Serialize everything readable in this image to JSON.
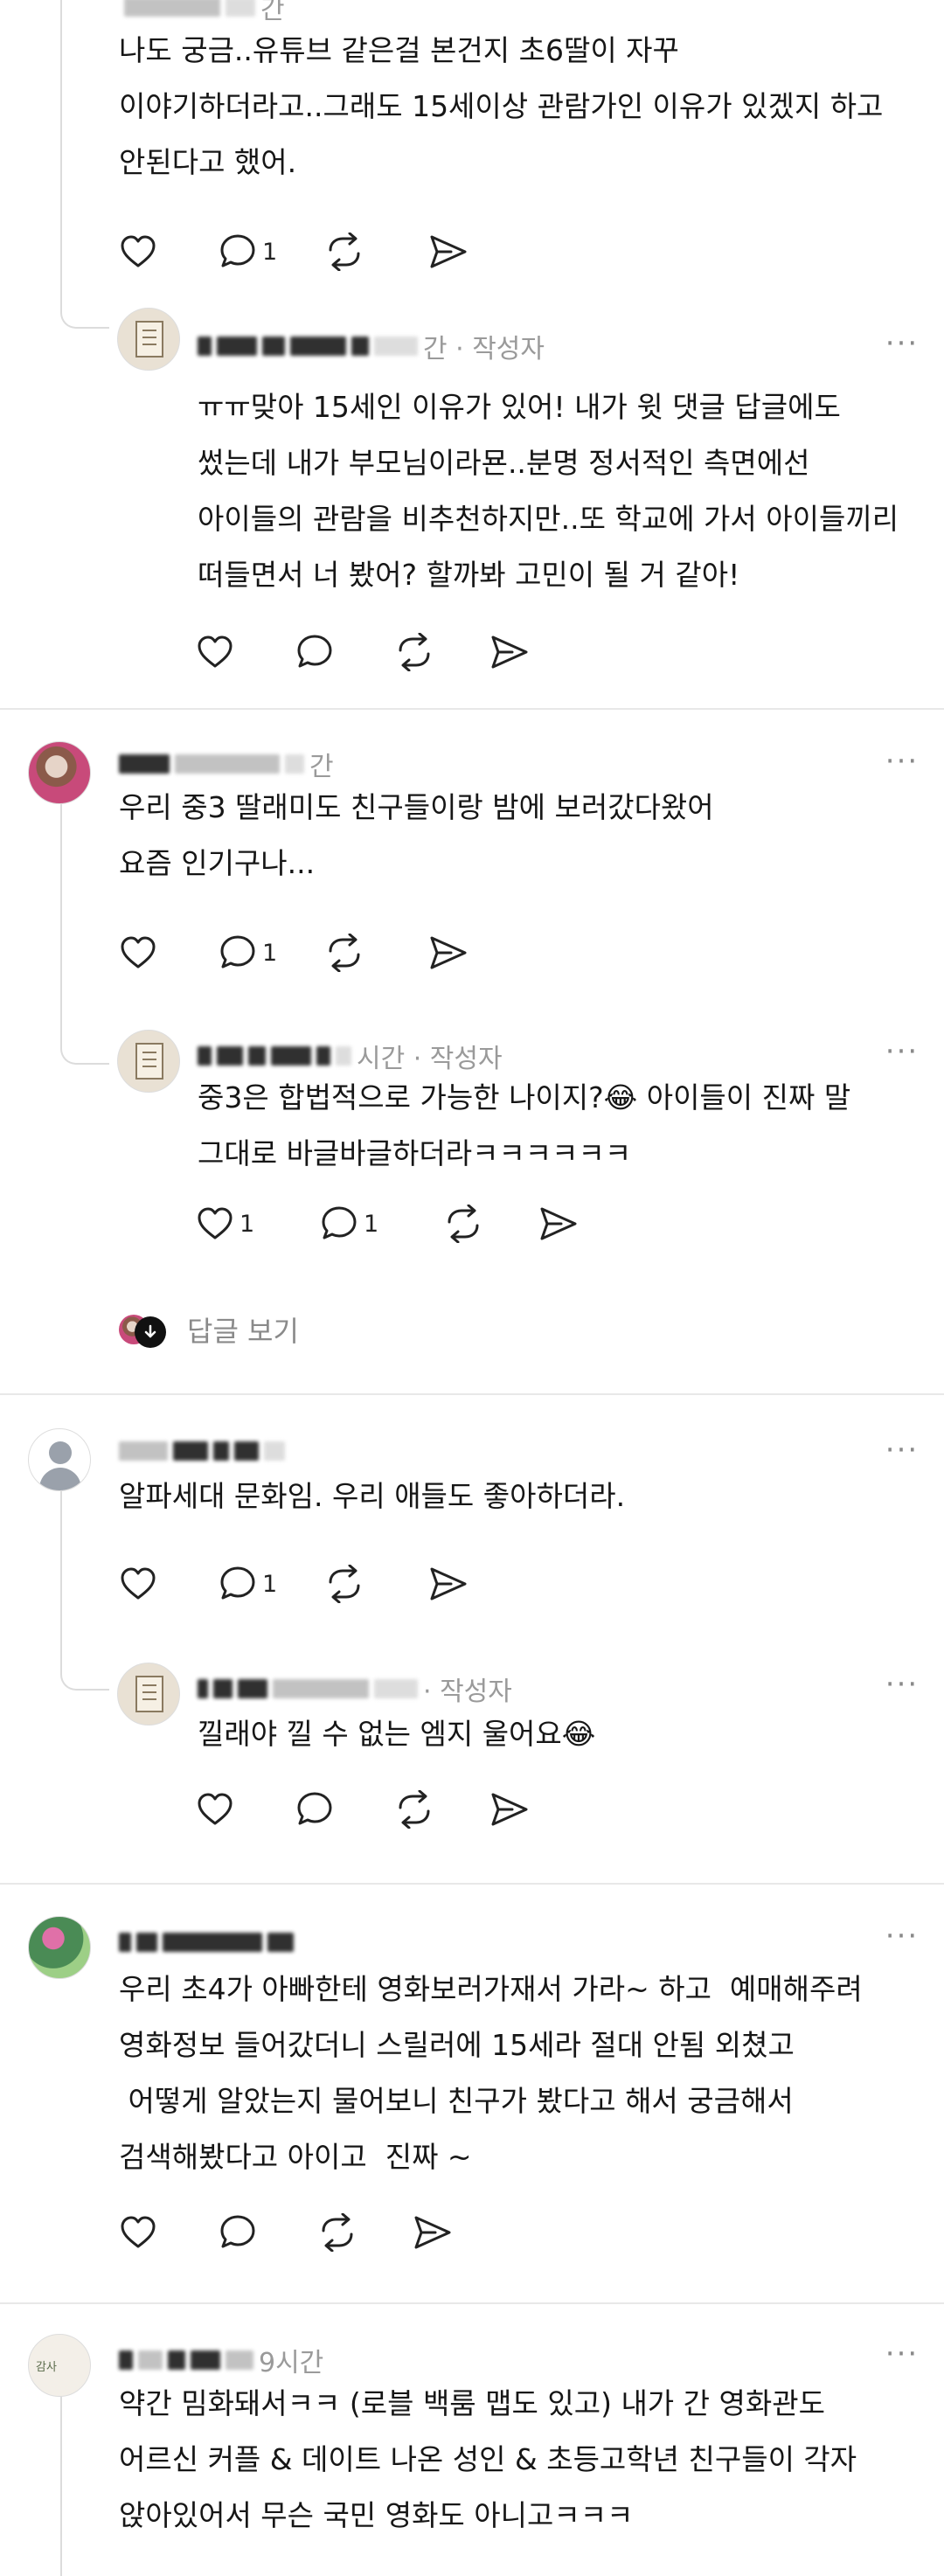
{
  "comments": [
    {
      "meta": "간",
      "body": "나도 궁금..유튜브 같은걸 본건지 초6딸이 자꾸\n이야기하더라고..그래도 15세이상 관람가인 이유가 있겠지 하고\n안된다고 했어.",
      "reply_count": "1",
      "reply": {
        "meta": "간 · 작성자",
        "body": "ㅠㅠ맞아 15세인 이유가 있어! 내가 윗 댓글 답글에도\n썼는데 내가 부모님이라묜..분명 정서적인 측면에선\n아이들의 관람을 비추천하지만..또 학교에 가서 아이들끼리\n떠들면서 너 봤어? 할까봐 고민이 될 거 같아!"
      }
    },
    {
      "meta": "간",
      "body": "우리 중3 딸래미도 친구들이랑 밤에 보러갔다왔어\n요즘 인기구나...",
      "reply_count": "1",
      "reply": {
        "meta": "시간 · 작성자",
        "body": "중3은 합법적으로 가능한 나이지?😂 아이들이 진짜 말\n그대로 바글바글하더라ㅋㅋㅋㅋㅋㅋ",
        "like_count": "1",
        "reply_count": "1"
      },
      "view_replies": "답글 보기"
    },
    {
      "body": "알파세대 문화임. 우리 애들도 좋아하더라.",
      "reply_count": "1",
      "reply": {
        "meta": "· 작성자",
        "body": "낄래야 낄 수 없는 엠지 울어요😂"
      }
    },
    {
      "body": "우리 초4가 아빠한테 영화보러가재서 가라~ 하고  예매해주려\n영화정보 들어갔더니 스릴러에 15세라 절대 안됨 외쳤고\n 어떻게 알았는지 물어보니 친구가 봤다고 해서 궁금해서\n검색해봤다고 아이고  진짜 ~"
    },
    {
      "meta": "9시간",
      "body": "약간 밈화돼서ㅋㅋ (로블 백룸 맵도 있고) 내가 간 영화관도\n어르신 커플 & 데이트 나온 성인 & 초등고학년 친구들이 각자\n앉아있어서 무슨 국민 영화도 아니고ㅋㅋㅋ"
    }
  ],
  "ui": {
    "more_icon": "more-icon",
    "like_icon": "heart-icon",
    "reply_icon": "chat-bubble-icon",
    "repost_icon": "repost-icon",
    "share_icon": "send-icon",
    "view_icon": "chevron-down-icon"
  },
  "colors": {
    "text": "#161616",
    "meta": "#9a9a9a",
    "divider": "#e8e8e8",
    "thread": "#dcdcdc"
  }
}
